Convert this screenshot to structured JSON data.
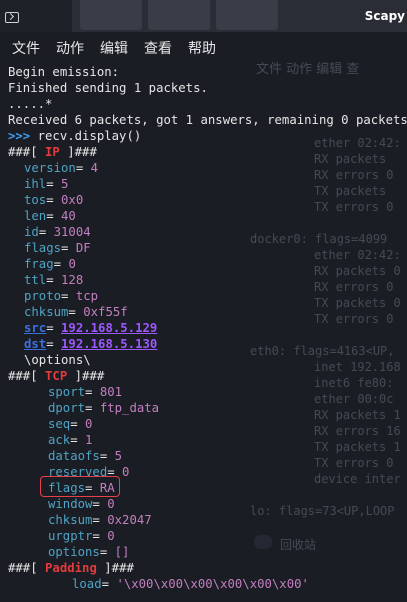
{
  "window": {
    "title": "Scapy"
  },
  "menu": [
    "文件",
    "动作",
    "编辑",
    "查看",
    "帮助"
  ],
  "ghost": {
    "menu": "文件 动作 编辑 查",
    "lines": [
      "ether 02:42:",
      "RX packets",
      "RX errors 0",
      "TX packets",
      "TX errors 0",
      "docker0: flags=4099",
      "ether 02:42:",
      "RX packets 0",
      "RX errors 0",
      "TX packets 0",
      "TX errors 0",
      "eth0: flags=4163<UP,",
      "inet 192.168",
      "inet6 fe80:",
      "ether 00:0c",
      "RX packets 1",
      "RX errors 16",
      "TX packets 1",
      "TX errors 0",
      "device inter",
      "lo: flags=73<UP,LOOP",
      "回收站"
    ]
  },
  "terminal": {
    "begin": "Begin emission:",
    "finished": "Finished sending 1 packets.",
    "dots": ".....*",
    "received": "Received 6 packets, got 1 answers, remaining 0 packets",
    "prompt": ">>>",
    "command": "recv.display()",
    "ip_layer": "IP",
    "ip_fields": [
      {
        "name": "version",
        "value": "4"
      },
      {
        "name": "ihl",
        "value": "5"
      },
      {
        "name": "tos",
        "value": "0x0"
      },
      {
        "name": "len",
        "value": "40"
      },
      {
        "name": "id",
        "value": "31004"
      },
      {
        "name": "flags",
        "value": "DF"
      },
      {
        "name": "frag",
        "value": "0"
      },
      {
        "name": "ttl",
        "value": "128"
      },
      {
        "name": "proto",
        "value": "tcp"
      },
      {
        "name": "chksum",
        "value": "0xf55f"
      },
      {
        "name": "src",
        "value": "192.168.5.129"
      },
      {
        "name": "dst",
        "value": "192.168.5.130"
      }
    ],
    "options": "\\options\\",
    "tcp_layer": "TCP",
    "tcp_fields": [
      {
        "name": "sport",
        "value": "801"
      },
      {
        "name": "dport",
        "value": "ftp_data"
      },
      {
        "name": "seq",
        "value": "0"
      },
      {
        "name": "ack",
        "value": "1"
      },
      {
        "name": "dataofs",
        "value": "5"
      },
      {
        "name": "reserved",
        "value": "0"
      },
      {
        "name": "flags",
        "value": "RA"
      },
      {
        "name": "window",
        "value": "0"
      },
      {
        "name": "chksum",
        "value": "0x2047"
      },
      {
        "name": "urgptr",
        "value": "0"
      },
      {
        "name": "options",
        "value": "[]"
      }
    ],
    "padding_layer": "Padding",
    "padding_field": {
      "name": "load",
      "value": "'\\x00\\x00\\x00\\x00\\x00\\x00'"
    }
  },
  "colors": {
    "background": "#1b1d24",
    "field": "#4fa3c4",
    "value": "#c47fc0",
    "layer": "#e23b3b",
    "address": "#9b59ff",
    "prompt": "#3fa0f5",
    "highlight": "#e8404a"
  }
}
